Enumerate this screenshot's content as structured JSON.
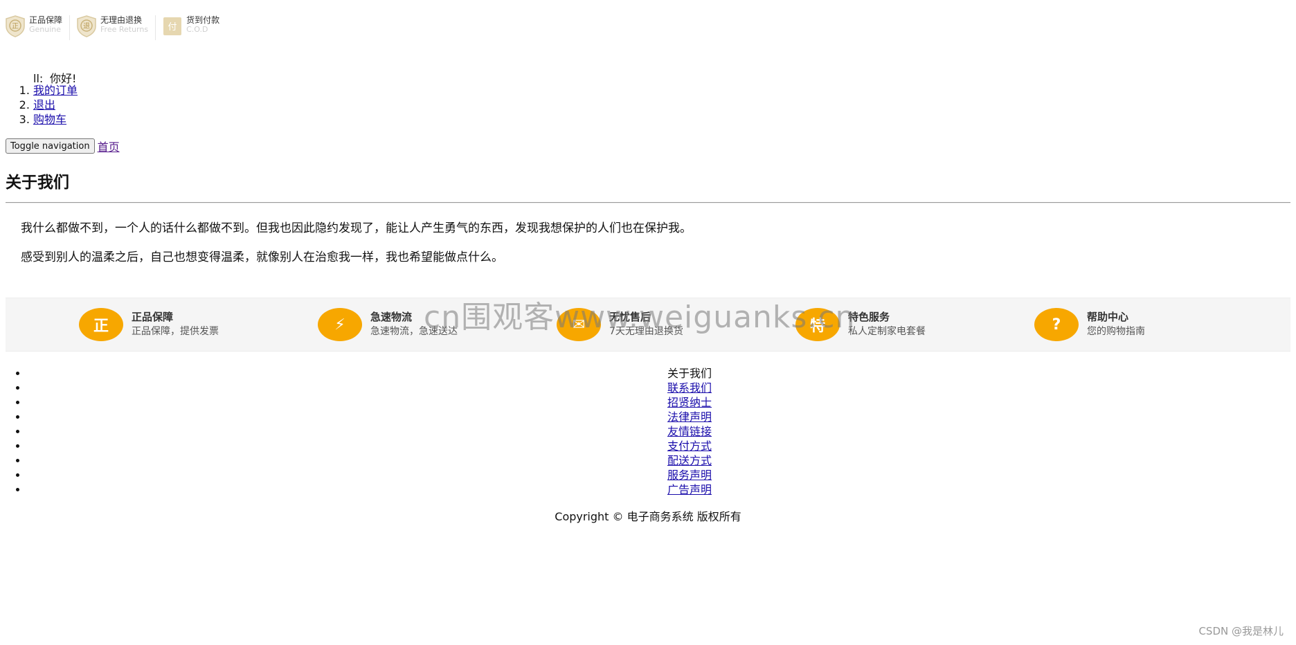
{
  "top_badges": [
    {
      "icon": "genuine-shield-icon",
      "glyph": "正",
      "title": "正品保障",
      "subtitle": "Genuine"
    },
    {
      "icon": "return-shield-icon",
      "glyph": "退",
      "title": "无理由退换",
      "subtitle": "Free Returns"
    },
    {
      "icon": "cod-icon",
      "glyph": "付",
      "title": "货到付款",
      "subtitle": "C.O.D"
    }
  ],
  "greeting": {
    "marker": "ll:",
    "text": "你好!"
  },
  "user_links": [
    "我的订单",
    "退出",
    "购物车"
  ],
  "nav": {
    "toggle_label": "Toggle navigation",
    "home_label": "首页"
  },
  "page_title": "关于我们",
  "paragraphs": [
    "我什么都做不到，一个人的话什么都做不到。但我也因此隐约发现了，能让人产生勇气的东西，发现我想保护的人们也在保护我。",
    "感受到别人的温柔之后，自己也想变得温柔，就像别人在治愈我一样，我也希望能做点什么。"
  ],
  "features": [
    {
      "icon": "genuine-icon",
      "glyph": "正",
      "title": "正品保障",
      "subtitle": "正品保障，提供发票"
    },
    {
      "icon": "express-icon",
      "glyph": "⚡",
      "title": "急速物流",
      "subtitle": "急速物流，急速送达"
    },
    {
      "icon": "aftersale-icon",
      "glyph": "✉",
      "title": "无忧售后",
      "subtitle": "7天无理由退换货"
    },
    {
      "icon": "special-service-icon",
      "glyph": "特",
      "title": "特色服务",
      "subtitle": "私人定制家电套餐"
    },
    {
      "icon": "help-icon",
      "glyph": "?",
      "title": "帮助中心",
      "subtitle": "您的购物指南"
    }
  ],
  "watermark": "cn围观客www.weiguanks.cn",
  "footer_links": [
    {
      "label": "关于我们",
      "link": false
    },
    {
      "label": "联系我们",
      "link": true
    },
    {
      "label": "招贤纳士",
      "link": true
    },
    {
      "label": "法律声明",
      "link": true
    },
    {
      "label": "友情链接",
      "link": true
    },
    {
      "label": "支付方式",
      "link": true
    },
    {
      "label": "配送方式",
      "link": true
    },
    {
      "label": "服务声明",
      "link": true
    },
    {
      "label": "广告声明",
      "link": true
    }
  ],
  "copyright": "Copyright © 电子商务系统 版权所有",
  "csdn_mark": "CSDN @我是林儿",
  "colors": {
    "accent": "#f7a700",
    "badge_tan": "#d9c9a0"
  }
}
